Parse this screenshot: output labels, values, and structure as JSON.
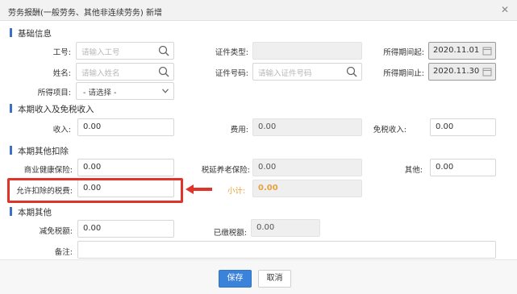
{
  "dialog": {
    "title": "劳务报酬(一般劳务、其他非连续劳务) 新增",
    "close_glyph": "✕"
  },
  "sections": {
    "basic": "基础信息",
    "income": "本期收入及免税收入",
    "deduct": "本期其他扣除",
    "other": "本期其他"
  },
  "basic": {
    "employee_id_label": "工号:",
    "employee_id_placeholder": "请输入工号",
    "name_label": "姓名:",
    "name_placeholder": "请输入姓名",
    "id_type_label": "证件类型:",
    "id_type_value": "",
    "id_number_label": "证件号码:",
    "id_number_placeholder": "请输入证件号码",
    "period_start_label": "所得期间起:",
    "period_start_value": "2020.11.01",
    "period_end_label": "所得期间止:",
    "period_end_value": "2020.11.30",
    "income_item_label": "所得项目:",
    "income_item_value": "- 请选择 -"
  },
  "income": {
    "income_label": "收入:",
    "income_value": "0.00",
    "expense_label": "费用:",
    "expense_value": "0.00",
    "tax_free_label": "免税收入:",
    "tax_free_value": "0.00"
  },
  "deduct": {
    "health_ins_label": "商业健康保险:",
    "health_ins_value": "0.00",
    "pension_label": "税延养老保险:",
    "pension_value": "0.00",
    "other_label": "其他:",
    "other_value": "0.00",
    "allowed_tax_label": "允许扣除的税费:",
    "allowed_tax_value": "0.00",
    "subtotal_label": "小计:",
    "subtotal_value": "0.00"
  },
  "other": {
    "reduction_label": "减免税额:",
    "reduction_value": "0.00",
    "paid_label": "已缴税额:",
    "paid_value": "0.00",
    "remark_label": "备注:",
    "remark_value": ""
  },
  "footer": {
    "save": "保存",
    "cancel": "取消"
  },
  "colors": {
    "accent": "#3b82db",
    "highlight": "#e0332a",
    "subtotal": "#e6a23c"
  },
  "icons": [
    "search-icon",
    "calendar-icon",
    "chevron-down-icon",
    "close-icon",
    "arrow-left-icon"
  ]
}
